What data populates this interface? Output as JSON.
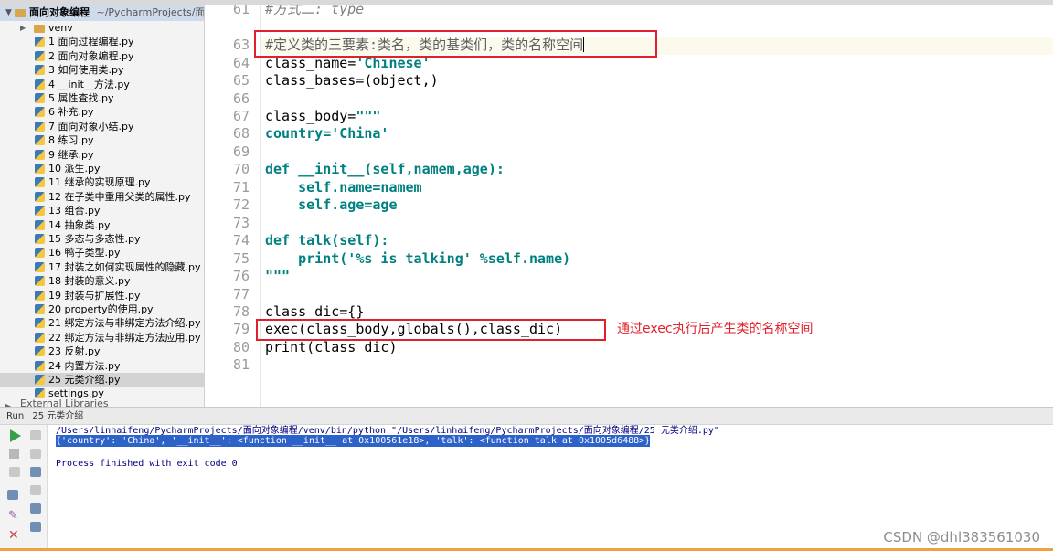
{
  "top_tabs": [
    "…",
    "…",
    "…",
    "…"
  ],
  "project": {
    "root_name": "面向对象编程",
    "root_path": "~/PycharmProjects/面向",
    "venv_label": "venv",
    "files": [
      "1 面向过程编程.py",
      "2 面向对象编程.py",
      "3 如何使用类.py",
      "4 __init__方法.py",
      "5 属性查找.py",
      "6 补充.py",
      "7 面向对象小结.py",
      "8 练习.py",
      "9 继承.py",
      "10 派生.py",
      "11 继承的实现原理.py",
      "12 在子类中重用父类的属性.py",
      "13 组合.py",
      "14 抽象类.py",
      "15 多态与多态性.py",
      "16 鸭子类型.py",
      "17 封装之如何实现属性的隐藏.py",
      "18 封装的意义.py",
      "19 封装与扩展性.py",
      "20 property的使用.py",
      "21 绑定方法与非绑定方法介绍.py",
      "22 绑定方法与非绑定方法应用.py",
      "23 反射.py",
      "24 内置方法.py",
      "25 元类介绍.py",
      "settings.py"
    ],
    "selected_file": "25 元类介绍.py",
    "external_libraries": "External Libraries"
  },
  "editor": {
    "line_numbers": [
      "61",
      "63",
      "64",
      "65",
      "66",
      "67",
      "68",
      "69",
      "70",
      "71",
      "72",
      "73",
      "74",
      "75",
      "76",
      "77",
      "78",
      "79",
      "80",
      "81"
    ],
    "line61_partial": "#方式二: type",
    "line63_comment": "#定义类的三要素:类名，类的基类们，类的名称空间",
    "line64_a": "class_name=",
    "line64_b": "'Chinese'",
    "line65": "class_bases=(object,)",
    "line67_a": "class_body=",
    "line67_b": "\"\"\"",
    "line68": "country='China'",
    "line70_a": "def ",
    "line70_b": "__init__(self,namem,age):",
    "line71": "    self.name=namem",
    "line72": "    self.age=age",
    "line74_a": "def ",
    "line74_b": "talk(self):",
    "line75": "    print('%s is talking' %self.name)",
    "line76": "\"\"\"",
    "line78": "class_dic={}",
    "line79": "exec(class_body,globals(),class_dic)",
    "line80": "print(class_dic)",
    "annotation": "通过exec执行后产生类的名称空间",
    "accent_color": "#e0202a"
  },
  "run": {
    "header_label": "Run",
    "tab_label": "25 元类介绍",
    "cmd_line": "/Users/linhaifeng/PycharmProjects/面向对象编程/venv/bin/python \"/Users/linhaifeng/PycharmProjects/面向对象编程/25 元类介绍.py\"",
    "output_line": "{'country': 'China', '__init__': <function __init__ at 0x100561e18>, 'talk': <function talk at 0x1005d6488>}",
    "exit_line": "Process finished with exit code 0"
  },
  "watermark": "CSDN @dhl383561030"
}
